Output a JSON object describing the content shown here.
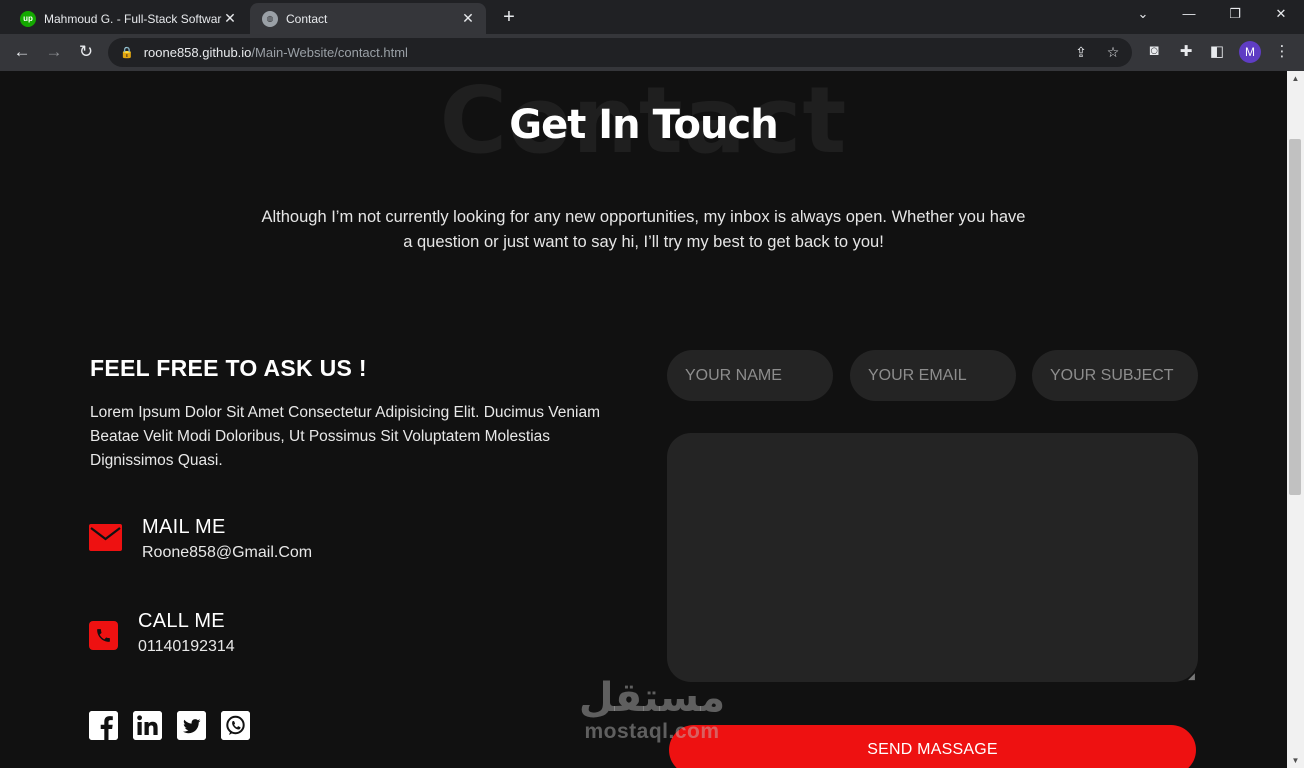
{
  "browser": {
    "tabs": [
      {
        "title": "Mahmoud G. - Full-Stack Softwar",
        "favicon": "upwork-icon",
        "active": false
      },
      {
        "title": "Contact",
        "favicon": "globe-icon",
        "active": true
      }
    ],
    "url_host": "roone858.github.io",
    "url_path": "/Main-Website/contact.html",
    "profile_initial": "M"
  },
  "page": {
    "bg_title": "Contact",
    "title": "Get In Touch",
    "intro": "Although I’m not currently looking for any new opportunities, my inbox is always open. Whether you have a question or just want to say hi, I’ll try my best to get back to you!",
    "ask_title": "FEEL FREE TO ASK US !",
    "ask_text": "Lorem Ipsum Dolor Sit Amet Consectetur Adipisicing Elit. Ducimus Veniam Beatae Velit Modi Doloribus, Ut Possimus Sit Voluptatem Molestias Dignissimos Quasi.",
    "mail": {
      "label": "MAIL ME",
      "value": "Roone858@Gmail.Com"
    },
    "call": {
      "label": "CALL ME",
      "value": "01140192314"
    },
    "socials": [
      "facebook-icon",
      "linkedin-icon",
      "twitter-icon",
      "whatsapp-icon"
    ]
  },
  "form": {
    "name_placeholder": "YOUR NAME",
    "email_placeholder": "YOUR EMAIL",
    "subject_placeholder": "YOUR SUBJECT",
    "message_value": "",
    "submit_label": "SEND MASSAGE"
  },
  "watermark": {
    "arabic": "مستقل",
    "latin": "mostaql.com"
  },
  "colors": {
    "accent": "#ee1111",
    "background": "#111111",
    "field": "#242424"
  }
}
